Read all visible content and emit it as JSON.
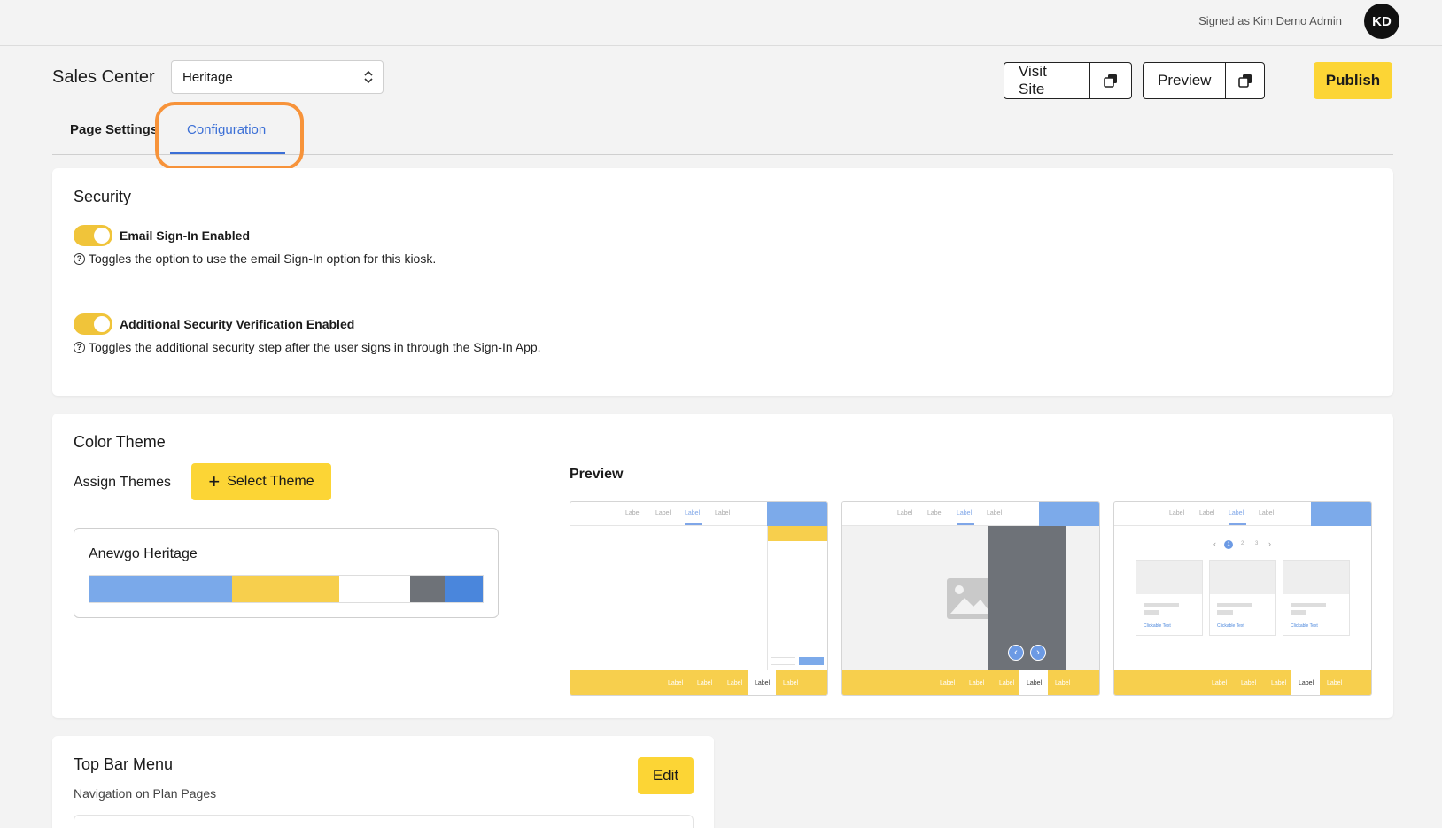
{
  "header": {
    "signed_as": "Signed as Kim Demo Admin",
    "avatar_initials": "KD"
  },
  "toolbar": {
    "title": "Sales Center",
    "site_select_value": "Heritage",
    "visit_site_label": "Visit Site",
    "preview_label": "Preview",
    "publish_label": "Publish"
  },
  "tabs": [
    {
      "label": "Page Settings",
      "active": false
    },
    {
      "label": "Configuration",
      "active": true
    }
  ],
  "security": {
    "title": "Security",
    "options": [
      {
        "label": "Email Sign-In Enabled",
        "enabled": true,
        "help": "Toggles the option to use the email Sign-In option for this kiosk."
      },
      {
        "label": "Additional Security Verification Enabled",
        "enabled": true,
        "help": "Toggles the additional security step after the user signs in through the Sign-In App."
      }
    ]
  },
  "color_theme": {
    "title": "Color Theme",
    "assign_label": "Assign Themes",
    "select_button": "Select Theme",
    "theme_name": "Anewgo Heritage",
    "swatches": [
      "#7aa9ea",
      "#f7cf4d",
      "#ffffff",
      "#6e7278",
      "#4a86dc"
    ],
    "preview_label": "Preview",
    "preview_nav_label": "Label",
    "preview_link_label": "Clickable Text",
    "preview_pages": [
      "1",
      "2",
      "3"
    ]
  },
  "top_bar_menu": {
    "title": "Top Bar Menu",
    "subtitle": "Navigation on Plan Pages",
    "edit_label": "Edit"
  },
  "colors": {
    "accent": "#fcd535",
    "link": "#3b6fd6",
    "highlight": "#f7933a"
  }
}
